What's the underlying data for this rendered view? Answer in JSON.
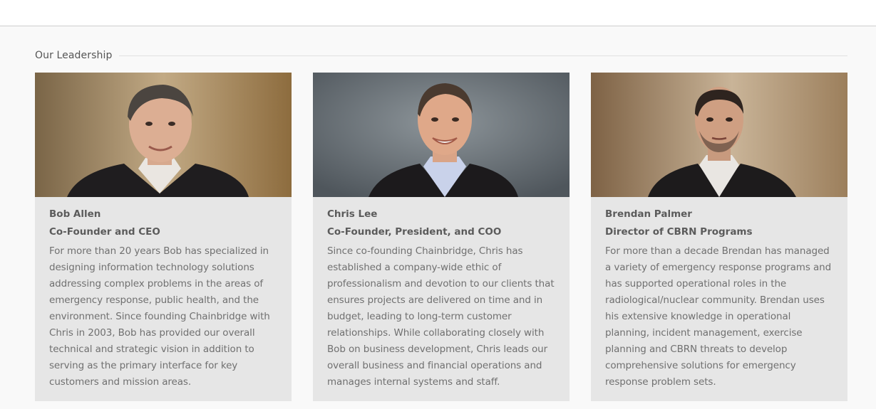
{
  "section": {
    "heading": "Our Leadership"
  },
  "team": [
    {
      "name": "Bob Allen",
      "role": "Co-Founder and CEO",
      "bio": "For more than 20 years Bob has specialized in designing information technology solutions addressing complex problems in the areas of emergency response, public health, and the environment. Since founding Chainbridge with Chris in 2003, Bob has provided our overall technical and strategic vision in addition to serving as the primary interface for key customers and mission areas.",
      "photo_bg": "#a88a62"
    },
    {
      "name": "Chris Lee",
      "role": "Co-Founder, President, and COO",
      "bio": "Since co-founding Chainbridge, Chris has established a company-wide ethic of professionalism and devotion to our clients that ensures projects are delivered on time and in budget, leading to long-term customer relationships. While collaborating closely with Bob on business development, Chris leads our overall business and financial operations and manages internal systems and staff.",
      "photo_bg": "#6f767c"
    },
    {
      "name": "Brendan Palmer",
      "role": "Director of CBRN Programs",
      "bio": "For more than a decade Brendan has managed a variety of emergency response programs and has supported operational roles in the radiological/nuclear community. Brendan uses his extensive knowledge in operational planning, incident management, exercise planning and CBRN threats to develop comprehensive solutions for emergency response problem sets.",
      "photo_bg": "#b09878"
    }
  ]
}
